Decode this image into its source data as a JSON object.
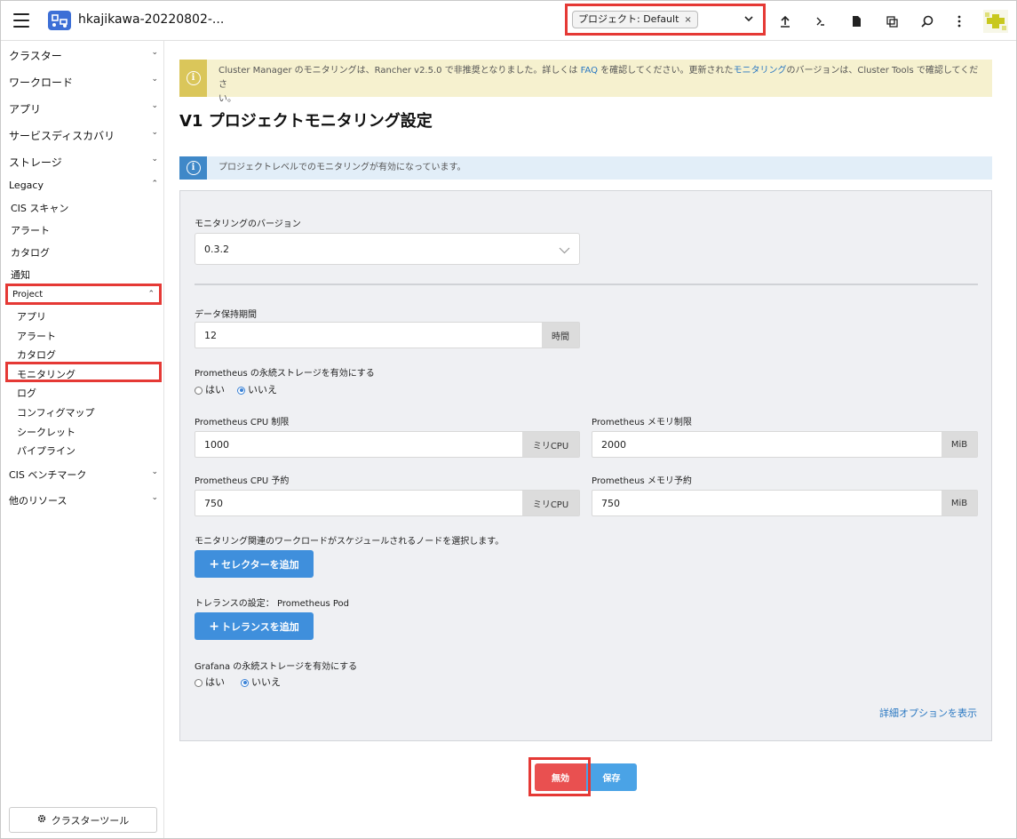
{
  "header": {
    "cluster_name": "hkajikawa-20220802-...",
    "project_chip": "プロジェクト: Default",
    "project_chip_remove": "×"
  },
  "sidebar": {
    "groups": {
      "cluster": "クラスター",
      "workload": "ワークロード",
      "apps": "アプリ",
      "service_discovery": "サービスディスカバリ",
      "storage": "ストレージ",
      "legacy": "Legacy",
      "project": "Project",
      "cis_benchmark": "CIS ベンチマーク",
      "more_resources": "他のリソース"
    },
    "legacy_items": [
      "CIS スキャン",
      "アラート",
      "カタログ",
      "通知"
    ],
    "project_items": [
      "アプリ",
      "アラート",
      "カタログ",
      "モニタリング",
      "ログ",
      "コンフィグマップ",
      "シークレット",
      "パイプライン"
    ],
    "cluster_tools": "クラスターツール"
  },
  "main": {
    "warning": {
      "p1": "Cluster Manager のモニタリングは、Rancher v2.5.0 で非推奨となりました。詳しくは ",
      "faq": "FAQ",
      "p2": " を確認してください。更新された",
      "monitoring": "モニタリング",
      "p3": "のバージョンは、Cluster Tools で確認してくださ",
      "p4": "い。"
    },
    "title": "V1 プロジェクトモニタリング設定",
    "info": "プロジェクトレベルでのモニタリングが有効になっています。",
    "form": {
      "version_label": "モニタリングのバージョン",
      "version_value": "0.3.2",
      "retention_label": "データ保持期間",
      "retention_value": "12",
      "retention_unit": "時間",
      "prom_storage_label": "Prometheus の永続ストレージを有効にする",
      "yes": "はい",
      "no": "いいえ",
      "cpu_limit_label": "Prometheus CPU 制限",
      "cpu_limit_value": "1000",
      "cpu_unit": "ミリCPU",
      "mem_limit_label": "Prometheus メモリ制限",
      "mem_limit_value": "2000",
      "mem_unit": "MiB",
      "cpu_reserve_label": "Prometheus CPU 予約",
      "cpu_reserve_value": "750",
      "mem_reserve_label": "Prometheus メモリ予約",
      "mem_reserve_value": "750",
      "node_select_label": "モニタリング関連のワークロードがスケジュールされるノードを選択します。",
      "add_selector": "セレクターを追加",
      "toleration_label": "トレランスの設定： Prometheus Pod",
      "add_toleration": "トレランスを追加",
      "grafana_storage_label": "Grafana の永続ストレージを有効にする",
      "advanced_link": "詳細オプションを表示"
    },
    "buttons": {
      "disable": "無効",
      "save": "保存"
    }
  },
  "colors": {
    "accent": "#3f8fdc",
    "danger": "#e95050",
    "warning_bg": "#f6f1cf",
    "info_bg": "#e2eef8",
    "highlight": "#e53935"
  }
}
